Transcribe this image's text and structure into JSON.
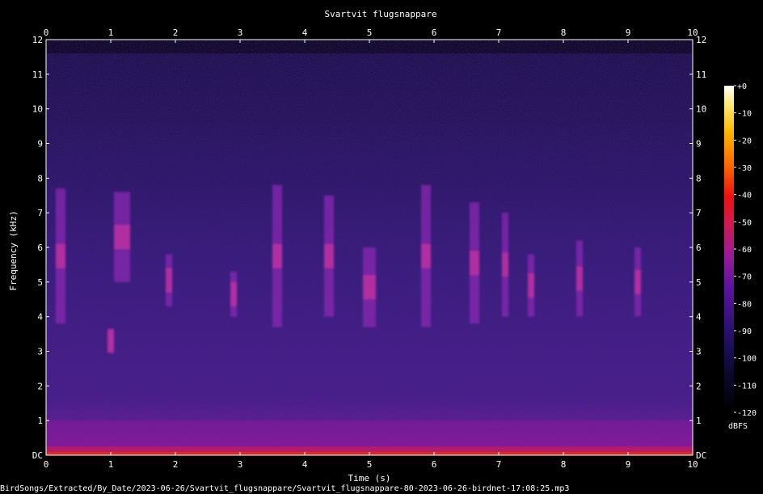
{
  "chart_data": {
    "type": "heatmap",
    "title": "Svartvit flugsnappare",
    "xlabel": "Time (s)",
    "ylabel": "Frequency (kHz)",
    "xlim": [
      0,
      10
    ],
    "ylim": [
      0,
      12
    ],
    "x_ticks": [
      "0",
      "1",
      "2",
      "3",
      "4",
      "5",
      "6",
      "7",
      "8",
      "9",
      "10"
    ],
    "y_ticks": [
      "DC",
      "1",
      "2",
      "3",
      "4",
      "5",
      "6",
      "7",
      "8",
      "9",
      "10",
      "11",
      "12"
    ],
    "colorbar": {
      "unit": "dBFS",
      "range": [
        -120,
        0
      ],
      "ticks": [
        "+0",
        "-10",
        "-20",
        "-30",
        "-40",
        "-50",
        "-60",
        "-70",
        "-80",
        "-90",
        "-100",
        "-110",
        "-120"
      ]
    },
    "noise_ceiling_khz": 11.6,
    "song_events": [
      {
        "t0": 0.15,
        "t1": 0.3,
        "f0": 3.8,
        "f1": 7.7
      },
      {
        "t0": 0.95,
        "t1": 1.05,
        "f0": 3.0,
        "f1": 3.6
      },
      {
        "t0": 1.05,
        "t1": 1.3,
        "f0": 5.0,
        "f1": 7.6
      },
      {
        "t0": 1.85,
        "t1": 1.95,
        "f0": 4.3,
        "f1": 5.8
      },
      {
        "t0": 2.85,
        "t1": 2.95,
        "f0": 4.0,
        "f1": 5.3
      },
      {
        "t0": 3.5,
        "t1": 3.65,
        "f0": 3.7,
        "f1": 7.8
      },
      {
        "t0": 4.3,
        "t1": 4.45,
        "f0": 4.0,
        "f1": 7.5
      },
      {
        "t0": 4.9,
        "t1": 5.1,
        "f0": 3.7,
        "f1": 6.0
      },
      {
        "t0": 5.8,
        "t1": 5.95,
        "f0": 3.7,
        "f1": 7.8
      },
      {
        "t0": 6.55,
        "t1": 6.7,
        "f0": 3.8,
        "f1": 7.3
      },
      {
        "t0": 7.05,
        "t1": 7.15,
        "f0": 4.0,
        "f1": 7.0
      },
      {
        "t0": 7.45,
        "t1": 7.55,
        "f0": 4.0,
        "f1": 5.8
      },
      {
        "t0": 8.2,
        "t1": 8.3,
        "f0": 4.0,
        "f1": 6.2
      },
      {
        "t0": 9.1,
        "t1": 9.2,
        "f0": 4.0,
        "f1": 6.0
      }
    ]
  },
  "footer": {
    "file_path": "BirdSongs/Extracted/By_Date/2023-06-26/Svartvit_flugsnappare/Svartvit_flugsnappare-80-2023-06-26-birdnet-17:08:25.mp3"
  }
}
